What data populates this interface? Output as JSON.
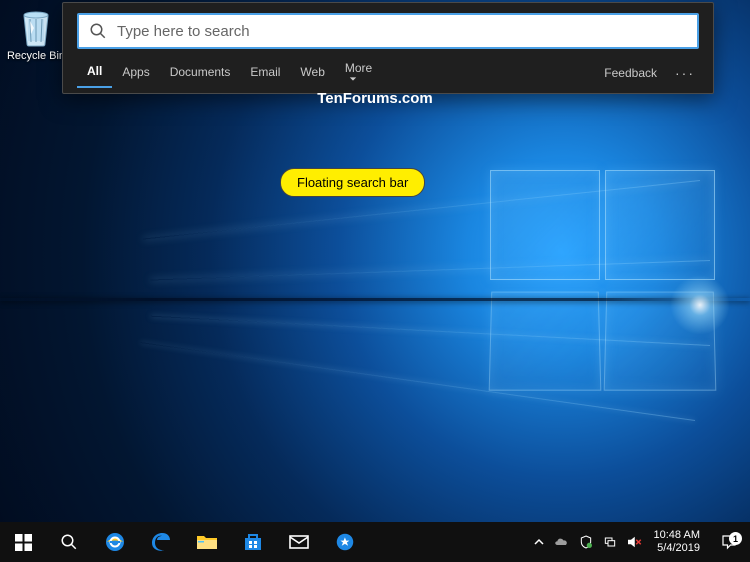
{
  "desktop": {
    "recycle_bin_label": "Recycle Bin"
  },
  "search": {
    "placeholder": "Type here to search",
    "value": "",
    "tabs": {
      "all": "All",
      "apps": "Apps",
      "documents": "Documents",
      "email": "Email",
      "web": "Web",
      "more": "More"
    },
    "feedback": "Feedback",
    "more_menu": "···"
  },
  "watermark": "TenForums.com",
  "annotation": {
    "callout": "Floating search bar"
  },
  "taskbar": {
    "icons": {
      "start": "windows-logo-icon",
      "search": "search-icon",
      "ie": "internet-explorer-icon",
      "edge": "edge-icon",
      "explorer": "file-explorer-icon",
      "store": "microsoft-store-icon",
      "mail": "mail-icon",
      "tips": "tips-icon"
    }
  },
  "systray": {
    "time": "10:48 AM",
    "date": "5/4/2019",
    "notification_count": "1"
  }
}
